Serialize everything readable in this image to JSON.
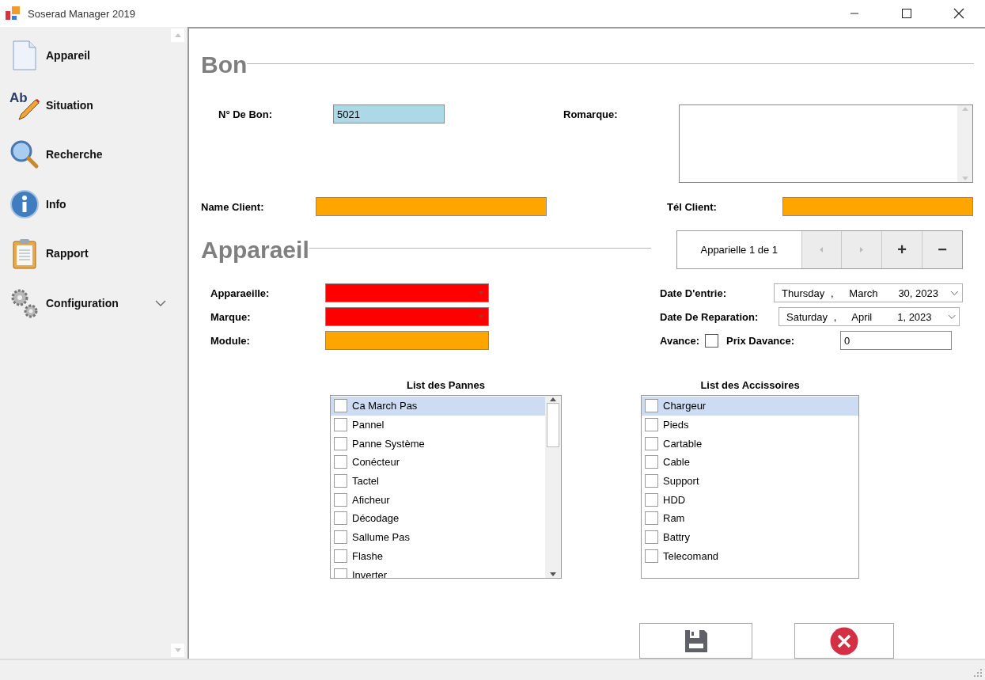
{
  "window": {
    "title": "Soserad Manager 2019"
  },
  "sidebar": {
    "items": [
      {
        "label": "Appareil",
        "kind": "link"
      },
      {
        "label": "Situation",
        "kind": "link",
        "icon_label": "Ab"
      },
      {
        "label": "Recherche",
        "kind": "link"
      },
      {
        "label": "Info",
        "kind": "link"
      },
      {
        "label": "Rapport",
        "kind": "link"
      },
      {
        "label": "Configuration",
        "kind": "group"
      }
    ]
  },
  "bon": {
    "title": "Bon",
    "number": {
      "label": "N° De Bon:",
      "value": "5021"
    },
    "remark": {
      "label": "Romarque:"
    },
    "client_name": {
      "label": "Name Client:"
    },
    "client_phone": {
      "label": "Tél Client:"
    }
  },
  "appareil": {
    "title": "Apparaeil",
    "navigator": {
      "label": "Apparielle 1 de 1",
      "buttons": [
        "+",
        "−"
      ]
    },
    "fields": [
      {
        "label": "Apparaeille:",
        "kind": "dropdown"
      },
      {
        "label": "Marque:",
        "kind": "dropdown"
      },
      {
        "label": "Module:",
        "kind": "text"
      }
    ],
    "dates": [
      {
        "label": "Date D'entrie:",
        "weekday": "Thursday",
        "separator": ",",
        "month": "March",
        "day": "30, 2023"
      },
      {
        "label": "Date De Reparation:",
        "weekday": "Saturday",
        "separator": ",",
        "month": "April",
        "day": "1, 2023"
      }
    ],
    "avance": {
      "label": "Avance:",
      "checked": false
    },
    "prix": {
      "label": "Prix Davance:",
      "value": "0"
    }
  },
  "lists": [
    {
      "title": "List des Pannes",
      "scrollbar": true,
      "items": [
        {
          "label": "Ca March Pas",
          "checked": false,
          "selected": true
        },
        {
          "label": "Pannel",
          "checked": false,
          "selected": false
        },
        {
          "label": "Panne Système",
          "checked": false,
          "selected": false
        },
        {
          "label": "Conécteur",
          "checked": false,
          "selected": false
        },
        {
          "label": "Tactel",
          "checked": false,
          "selected": false
        },
        {
          "label": "Aficheur",
          "checked": false,
          "selected": false
        },
        {
          "label": "Décodage",
          "checked": false,
          "selected": false
        },
        {
          "label": "Sallume Pas",
          "checked": false,
          "selected": false
        },
        {
          "label": "Flashe",
          "checked": false,
          "selected": false
        },
        {
          "label": "Inverter",
          "checked": false,
          "selected": false
        }
      ]
    },
    {
      "title": "List des Accissoires",
      "scrollbar": false,
      "items": [
        {
          "label": "Chargeur",
          "checked": false,
          "selected": true
        },
        {
          "label": "Pieds",
          "checked": false,
          "selected": false
        },
        {
          "label": "Cartable",
          "checked": false,
          "selected": false
        },
        {
          "label": "Cable",
          "checked": false,
          "selected": false
        },
        {
          "label": "Support",
          "checked": false,
          "selected": false
        },
        {
          "label": "HDD",
          "checked": false,
          "selected": false
        },
        {
          "label": "Ram",
          "checked": false,
          "selected": false
        },
        {
          "label": "Battry",
          "checked": false,
          "selected": false
        },
        {
          "label": "Telecomand",
          "checked": false,
          "selected": false
        }
      ]
    }
  ]
}
